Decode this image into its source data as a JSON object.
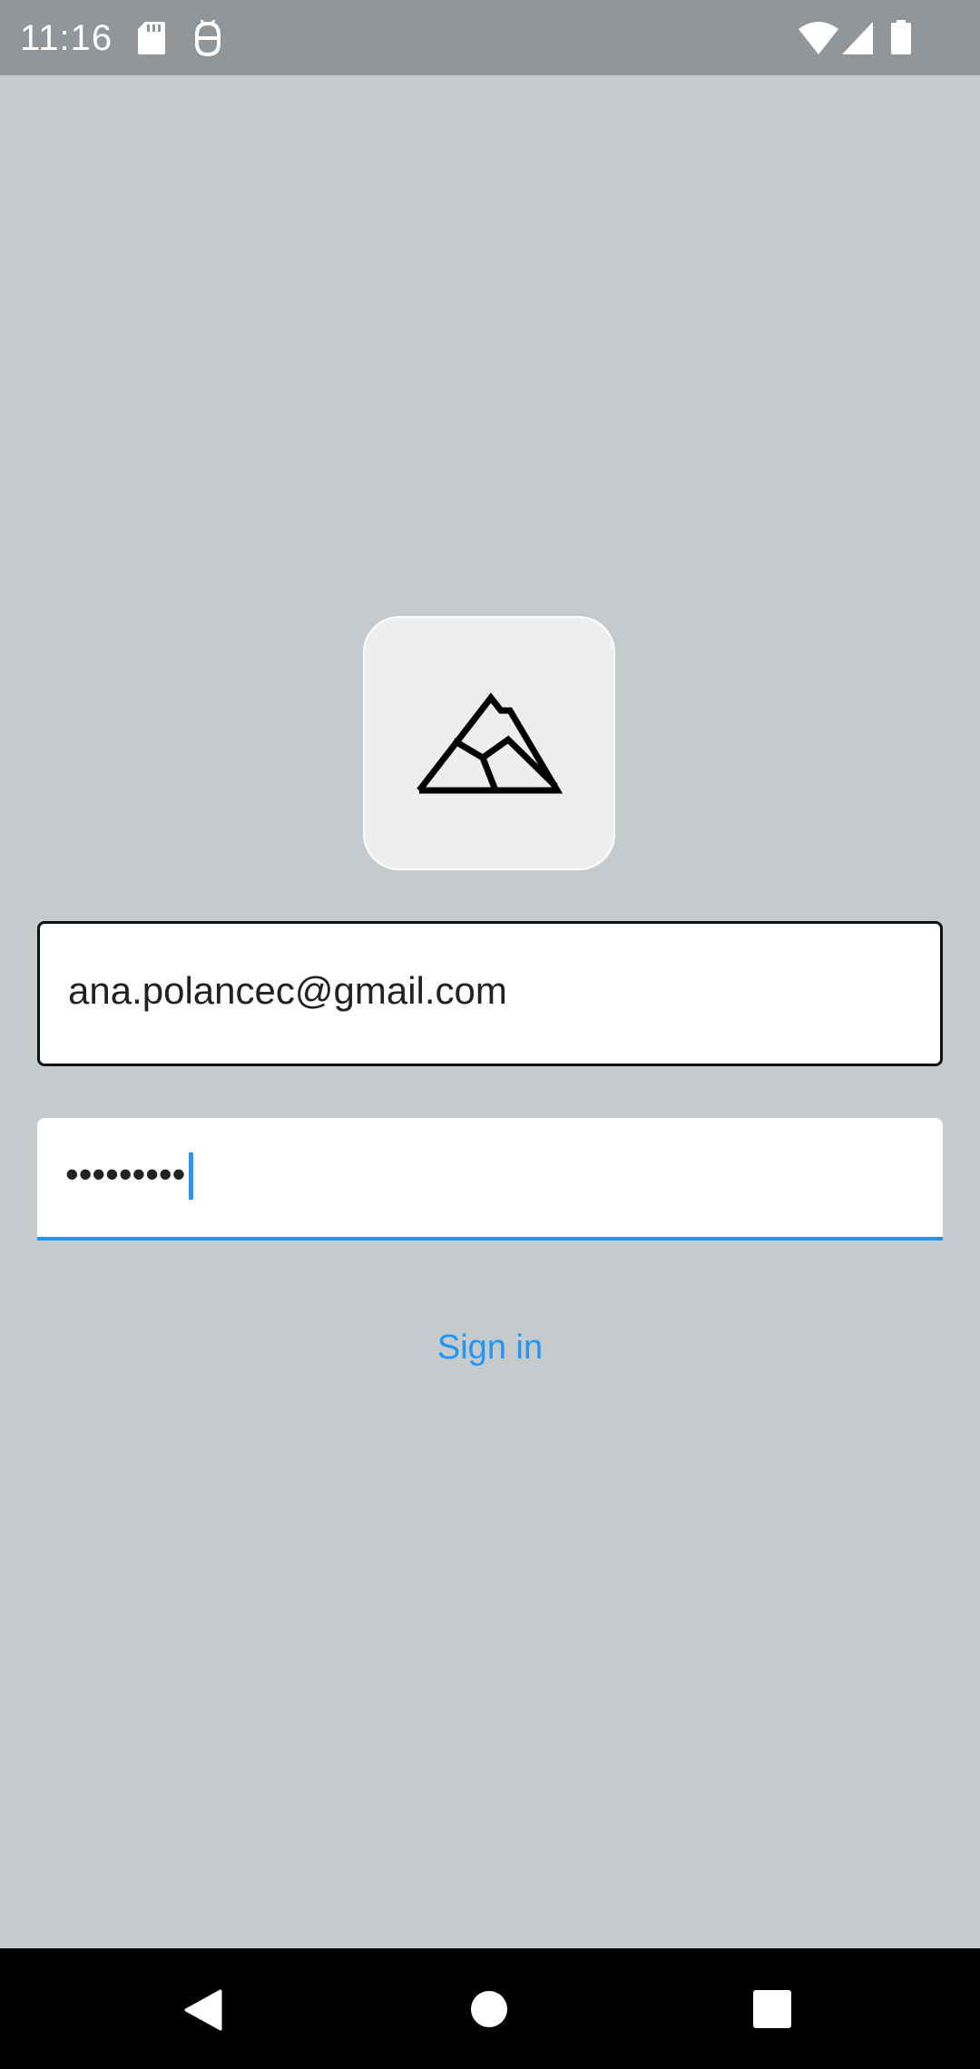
{
  "status_bar": {
    "time": "11:16",
    "icons": [
      "sd-card-icon",
      "debug-icon",
      "wifi-icon",
      "cellular-signal-icon",
      "battery-icon"
    ]
  },
  "logo": {
    "icon": "mountain-icon"
  },
  "email_field": {
    "value": "ana.polancec@gmail.com"
  },
  "password_field": {
    "masked_value": "•••••••••"
  },
  "sign_in": {
    "label": "Sign in"
  },
  "nav_bar": {
    "buttons": [
      "back-icon",
      "home-icon",
      "recents-icon"
    ]
  },
  "colors": {
    "accent": "#2196f3",
    "background": "#c5cacd",
    "status_bar": "#939699"
  }
}
